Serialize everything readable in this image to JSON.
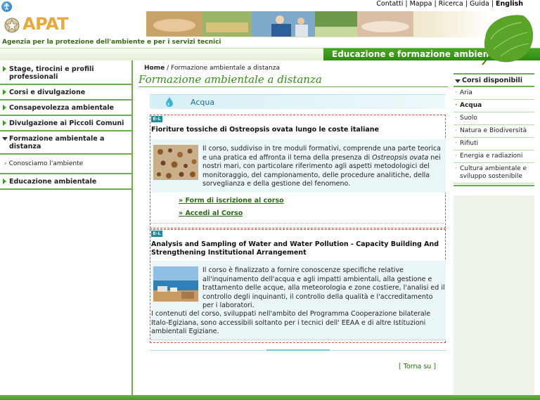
{
  "header": {
    "logo_text": "APAT",
    "agency_text": "Agenzia per la protezione dell'ambiente e per i servizi tecnici",
    "section_title": "Educazione e formazione ambientale",
    "top_links": [
      {
        "label": "Contatti"
      },
      {
        "label": "Mappa"
      },
      {
        "label": "Ricerca"
      },
      {
        "label": "Guida"
      },
      {
        "label": "English"
      }
    ],
    "separator": "|"
  },
  "leftnav": {
    "items": [
      {
        "label": "Stage, tirocini e profili professionali"
      },
      {
        "label": "Corsi e divulgazione"
      },
      {
        "label": "Consapevolezza ambientale"
      },
      {
        "label": "Divulgazione ai Piccoli Comuni"
      },
      {
        "label": "Formazione ambientale a distanza"
      },
      {
        "label": "Conosciamo l'ambiente"
      },
      {
        "label": "Educazione ambientale"
      }
    ]
  },
  "main": {
    "breadcrumb": {
      "home": "Home",
      "separator": "/",
      "current": "Formazione ambientale a distanza"
    },
    "page_title": "Formazione ambientale a distanza",
    "category": "Acqua",
    "courses": [
      {
        "badge": "E-L",
        "title": "Fioriture tossiche di Ostreopsis ovata lungo le coste italiane",
        "desc_before": "Il corso, suddiviso in tre moduli formativi, comprende una parte teorica e una pratica ed affronta il tema della presenza di ",
        "desc_em": "Ostreopsis ovata",
        "desc_after": " nei nostri mari, con particolare riferimento agli aspetti metodologici del monitoraggio, del campionamento, delle procedure analitiche, della sorveglianza e della gestione del fenomeno.",
        "link_marker": "»",
        "link_form": "Form di iscrizione al corso",
        "link_access": "Accedi al Corso"
      },
      {
        "badge": "E-L",
        "title": "Analysis and Sampling of Water and Water Pollution - Capacity Building And Strengthening Institutional Arrangement",
        "desc": "Il corso è finalizzato a fornire conoscenze specifiche relative all'inquinamento dell'acqua e agli impatti ambientali, alla gestione e trattamento delle acque, alla meteorologia e zone costiere, l'analisi ed il controllo degli inquinanti, il controllo della qualità e l'accreditamento per i laboratori.",
        "desc2": "I contenuti del corso, sviluppati nell'ambito del Programma Cooperazione bilaterale Italo-Egiziana,  sono accessibili soltanto per i tecnici dell' EEAA e di altre Istituzioni ambientali Egiziane."
      }
    ],
    "back_to_top": "[ Torna su ]"
  },
  "rightcol": {
    "header": "Corsi disponibili",
    "items": [
      {
        "label": "Aria"
      },
      {
        "label": "Acqua"
      },
      {
        "label": "Suolo"
      },
      {
        "label": "Natura e Biodiversità"
      },
      {
        "label": "Rifiuti"
      },
      {
        "label": "Energia e radiazioni"
      },
      {
        "label": "Cultura ambientale e sviluppo sostenibile"
      }
    ],
    "bullet": "·"
  },
  "colors": {
    "brand_green": "#3d9a1c",
    "title_green": "#3b8a1e",
    "logo_gold": "#e7a93b",
    "course_border": "#e0483b",
    "category_blue": "#1a6e9a"
  }
}
